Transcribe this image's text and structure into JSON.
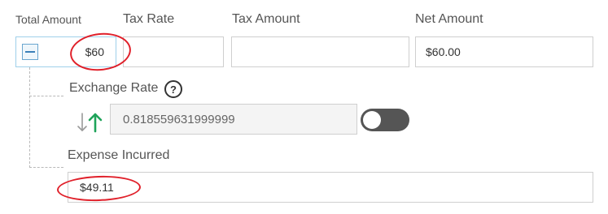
{
  "fields": {
    "total_amount": {
      "label": "Total Amount",
      "value": "$60"
    },
    "tax_rate": {
      "label": "Tax Rate",
      "value": ""
    },
    "tax_amount": {
      "label": "Tax Amount",
      "value": ""
    },
    "net_amount": {
      "label": "Net Amount",
      "value": "$60.00"
    }
  },
  "exchange": {
    "label": "Exchange Rate",
    "help_glyph": "?",
    "rate_value": "0.818559631999999",
    "toggle_on": false
  },
  "expense": {
    "label": "Expense Incurred",
    "value": "$49.11"
  },
  "colors": {
    "annotation_red": "#e0202a",
    "arrow_up_green": "#1fa35a",
    "arrow_down_gray": "#9a9a9a",
    "toggle_track": "#555555",
    "focus_border": "#9fd0ea"
  },
  "icons": {
    "collapse": "minus-square-icon",
    "help": "question-circle-icon",
    "swap": "swap-arrows-icon"
  }
}
